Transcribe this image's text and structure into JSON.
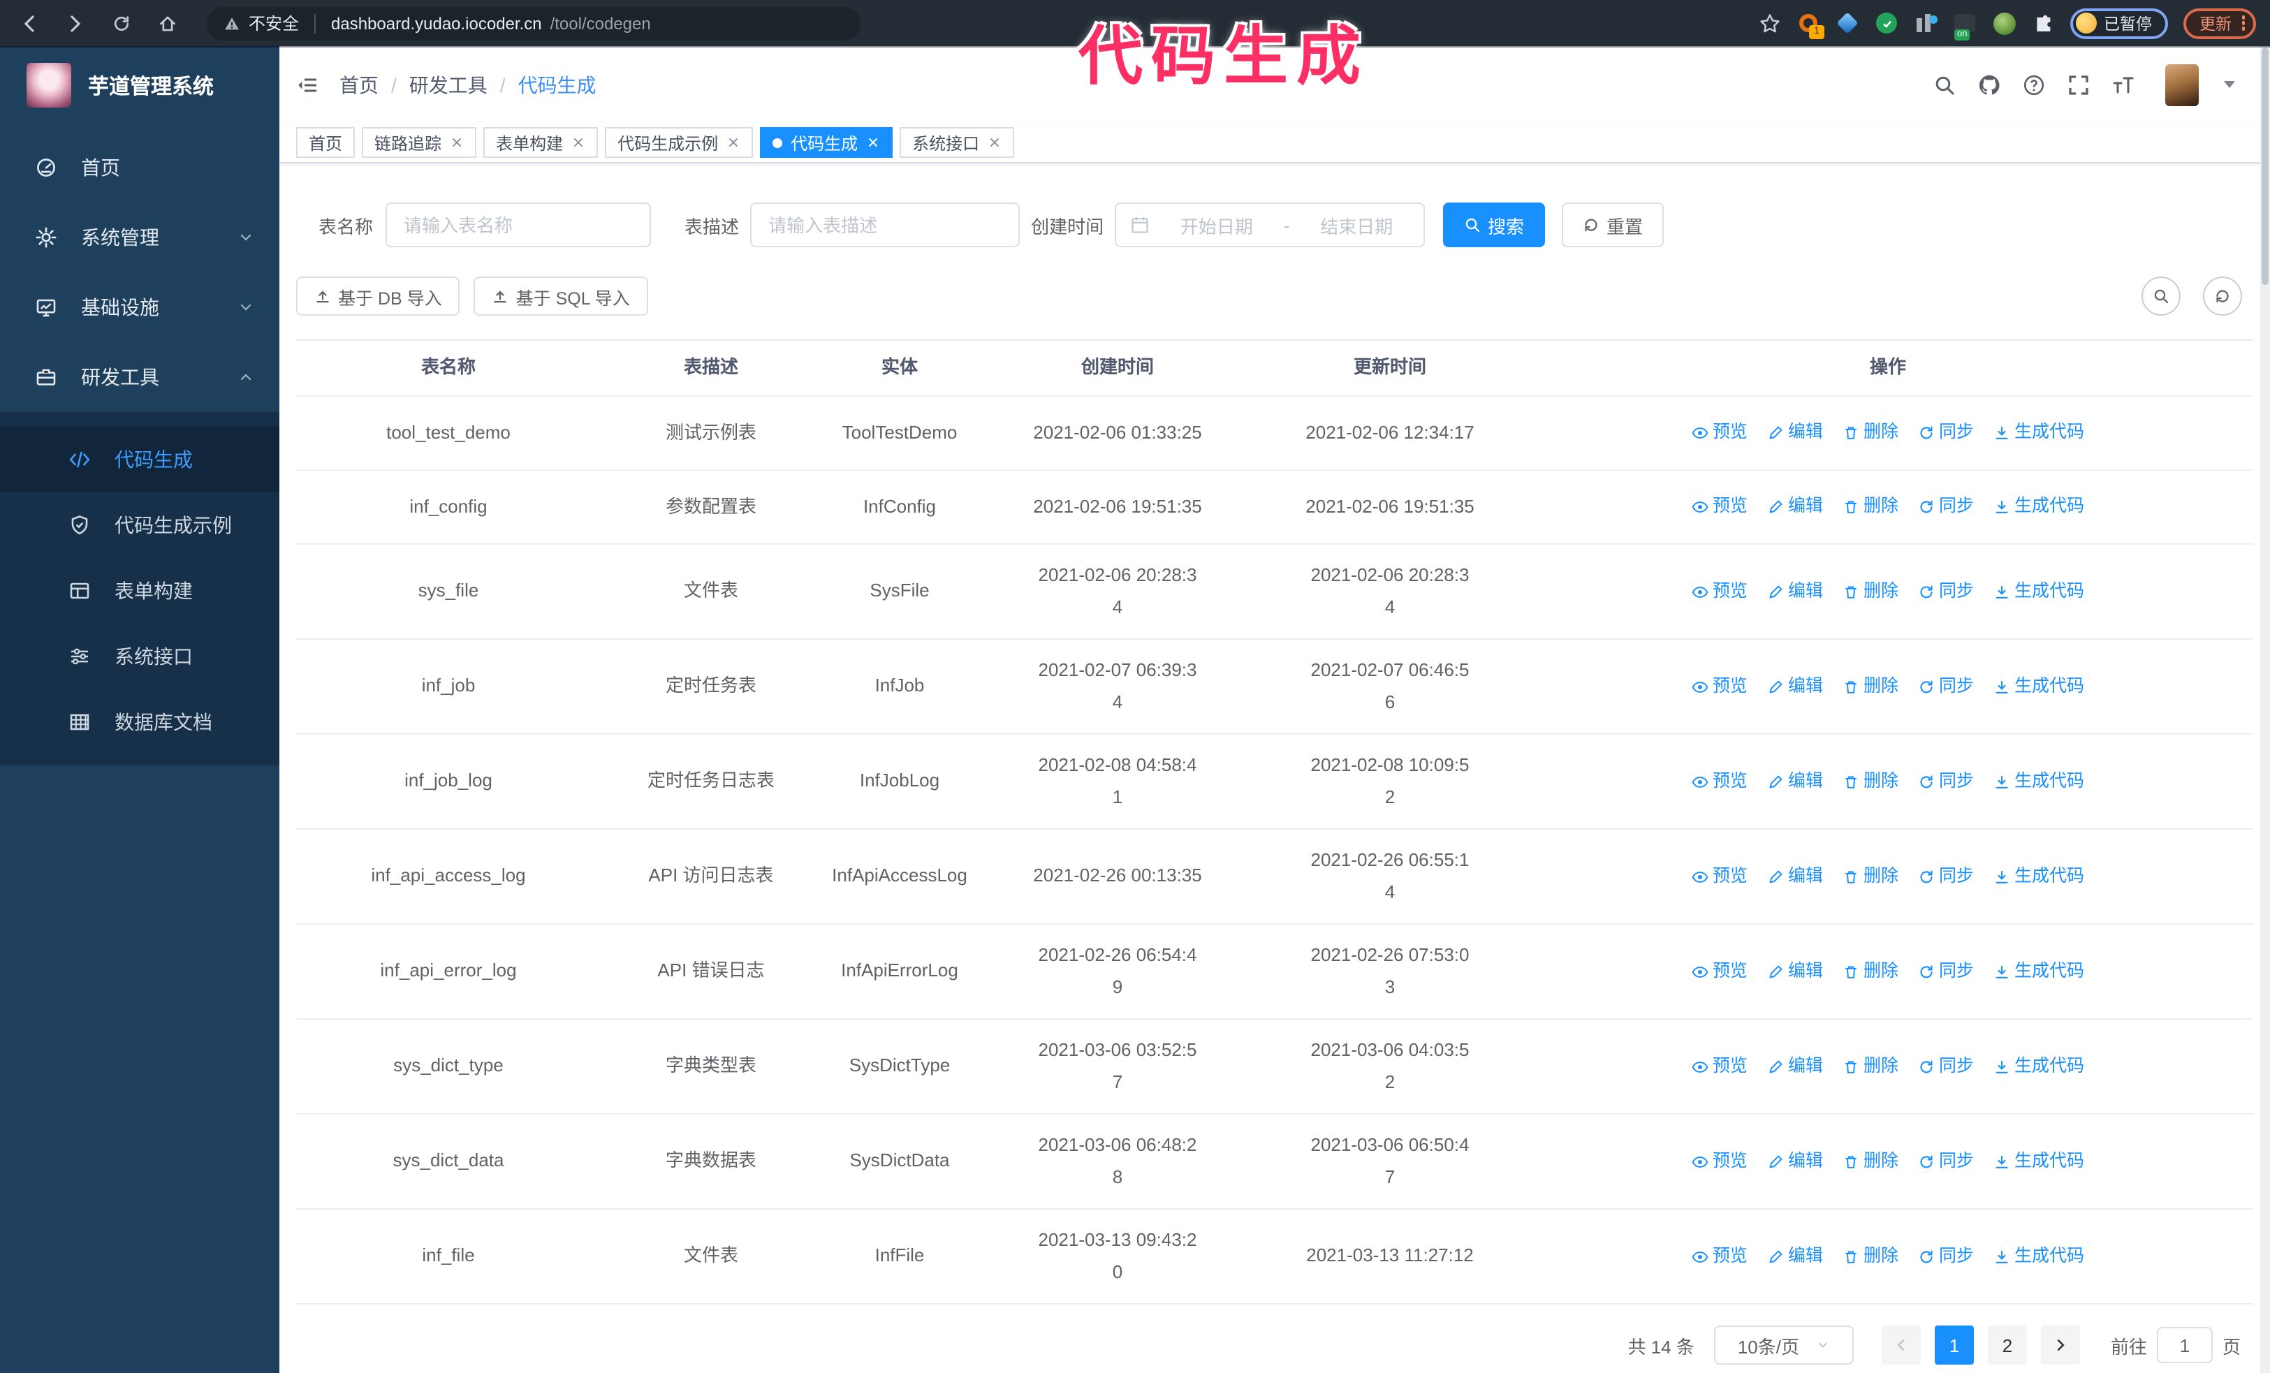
{
  "browser": {
    "security_label": "不安全",
    "url_host": "dashboard.yudao.iocoder.cn",
    "url_path": "/tool/codegen",
    "extension_badge": "1",
    "extension_on_label": "on",
    "profile_status": "已暂停",
    "update_label": "更新"
  },
  "annotation": {
    "text": "代码生成"
  },
  "sidebar": {
    "title": "芋道管理系统",
    "items": [
      {
        "label": "首页"
      },
      {
        "label": "系统管理"
      },
      {
        "label": "基础设施"
      },
      {
        "label": "研发工具"
      }
    ],
    "subitems": [
      {
        "label": "代码生成"
      },
      {
        "label": "代码生成示例"
      },
      {
        "label": "表单构建"
      },
      {
        "label": "系统接口"
      },
      {
        "label": "数据库文档"
      }
    ]
  },
  "breadcrumb": {
    "separator": "/",
    "items": [
      "首页",
      "研发工具",
      "代码生成"
    ]
  },
  "tabs": [
    {
      "label": "首页"
    },
    {
      "label": "链路追踪"
    },
    {
      "label": "表单构建"
    },
    {
      "label": "代码生成示例"
    },
    {
      "label": "代码生成"
    },
    {
      "label": "系统接口"
    }
  ],
  "filters": {
    "name_label": "表名称",
    "name_placeholder": "请输入表名称",
    "desc_label": "表描述",
    "desc_placeholder": "请输入表描述",
    "time_label": "创建时间",
    "start_placeholder": "开始日期",
    "range_separator": "-",
    "end_placeholder": "结束日期",
    "search_label": "搜索",
    "reset_label": "重置"
  },
  "toolbar": {
    "import_db_label": "基于 DB 导入",
    "import_sql_label": "基于 SQL 导入"
  },
  "table": {
    "columns": [
      "表名称",
      "表描述",
      "实体",
      "创建时间",
      "更新时间",
      "操作"
    ],
    "actions": [
      "预览",
      "编辑",
      "删除",
      "同步",
      "生成代码"
    ],
    "rows": [
      {
        "name": "tool_test_demo",
        "desc": "测试示例表",
        "entity": "ToolTestDemo",
        "created": "2021-02-06 01:33:25",
        "updated": "2021-02-06 12:34:17"
      },
      {
        "name": "inf_config",
        "desc": "参数配置表",
        "entity": "InfConfig",
        "created": "2021-02-06 19:51:35",
        "updated": "2021-02-06 19:51:35"
      },
      {
        "name": "sys_file",
        "desc": "文件表",
        "entity": "SysFile",
        "created": "2021-02-06 20:28:34",
        "updated": "2021-02-06 20:28:34"
      },
      {
        "name": "inf_job",
        "desc": "定时任务表",
        "entity": "InfJob",
        "created": "2021-02-07 06:39:34",
        "updated": "2021-02-07 06:46:56"
      },
      {
        "name": "inf_job_log",
        "desc": "定时任务日志表",
        "entity": "InfJobLog",
        "created": "2021-02-08 04:58:41",
        "updated": "2021-02-08 10:09:52"
      },
      {
        "name": "inf_api_access_log",
        "desc": "API 访问日志表",
        "entity": "InfApiAccessLog",
        "created": "2021-02-26 00:13:35",
        "updated": "2021-02-26 06:55:14"
      },
      {
        "name": "inf_api_error_log",
        "desc": "API 错误日志",
        "entity": "InfApiErrorLog",
        "created": "2021-02-26 06:54:49",
        "updated": "2021-02-26 07:53:03"
      },
      {
        "name": "sys_dict_type",
        "desc": "字典类型表",
        "entity": "SysDictType",
        "created": "2021-03-06 03:52:57",
        "updated": "2021-03-06 04:03:52"
      },
      {
        "name": "sys_dict_data",
        "desc": "字典数据表",
        "entity": "SysDictData",
        "created": "2021-03-06 06:48:28",
        "updated": "2021-03-06 06:50:47"
      },
      {
        "name": "inf_file",
        "desc": "文件表",
        "entity": "InfFile",
        "created": "2021-03-13 09:43:20",
        "updated": "2021-03-13 11:27:12"
      }
    ]
  },
  "pagination": {
    "total_label": "共 14 条",
    "page_size": "10条/页",
    "pages": [
      "1",
      "2"
    ],
    "active_page": "1",
    "goto_label": "前往",
    "goto_value": "1",
    "page_unit": "页"
  },
  "colors": {
    "primary": "#1890ff",
    "annotation_pink": "#fb2f63",
    "sidebar_bg": "#1f405c",
    "submenu_bg": "#16304a",
    "chrome_bg": "#242c35"
  }
}
